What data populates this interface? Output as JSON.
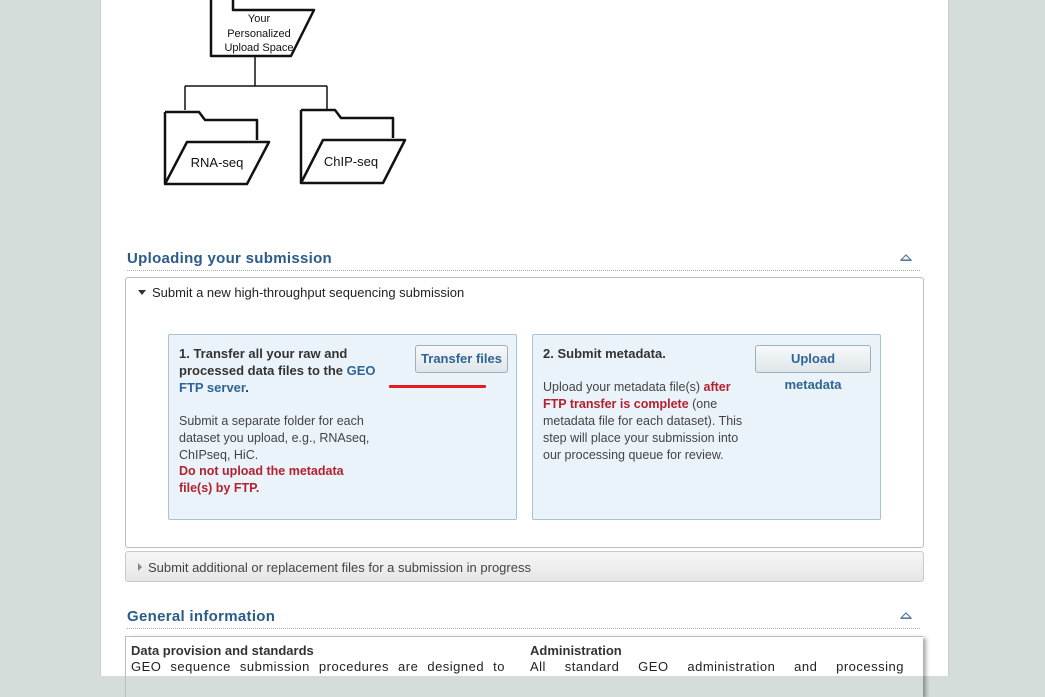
{
  "diagram": {
    "root_label_lines": [
      "Your",
      "Personalized",
      "Upload Space"
    ],
    "folders": [
      "RNA-seq",
      "ChIP-seq"
    ]
  },
  "uploading": {
    "heading": "Uploading your submission",
    "open_panel": {
      "header": "Submit a new high-throughput sequencing submission",
      "step1": {
        "title_prefix": "1. Transfer all your raw and processed data files to the",
        "title_link": "GEO FTP server",
        "title_suffix": ".",
        "button": "Transfer files",
        "body": "Submit a separate folder for each dataset you upload, e.g., RNAseq, ChIPseq, HiC.",
        "warning": "Do not upload the metadata file(s) by FTP."
      },
      "step2": {
        "title": "2. Submit metadata.",
        "button": "Upload metadata",
        "body_prefix": "Upload your metadata file(s)",
        "body_warning": "after FTP transfer is complete",
        "body_suffix": "(one metadata file for each dataset). This step will place your submission into our processing queue for review."
      }
    },
    "closed_panel": {
      "header": "Submit additional or replacement files for a submission in progress"
    }
  },
  "general": {
    "heading": "General information",
    "left": {
      "title": "Data provision and standards",
      "text": "GEO sequence submission procedures are designed to"
    },
    "right": {
      "title": "Administration",
      "text": "All standard GEO administration and processing"
    }
  },
  "colors": {
    "heading": "#2b5b8c",
    "link": "#2f6596",
    "warning": "#b5202e",
    "highlight_underline": "#e41c1c"
  }
}
